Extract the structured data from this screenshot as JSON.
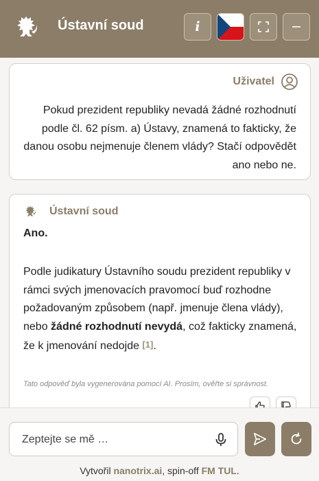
{
  "header": {
    "title": "Ústavní soud",
    "logo_icon": "heraldic-lion-icon",
    "buttons": {
      "info_label": "i",
      "flag_icon": "czech-flag-icon",
      "fullscreen_icon": "fullscreen-icon",
      "minimize_icon": "minimize-icon"
    },
    "background_color": "#8b7d67"
  },
  "messages": {
    "user": {
      "name": "Uživatel",
      "avatar_icon": "user-icon",
      "text": "Pokud prezident republiky nevadá žádné rozhodnutí podle čl. 62 písm. a) Ústavy, znamená to fakticky, že danou osobu nejmenuje členem vlády? Stačí odpovědět ano nebo ne."
    },
    "assistant": {
      "name": "Ústavní soud",
      "avatar_icon": "heraldic-lion-icon",
      "answer": "Ano.",
      "text_part1": "Podle judikatury Ústavního soudu prezident republiky v rámci svých jmenovacích pravomocí buď rozhodne požadovaným způsobem (např. jmenuje člena vlády), nebo ",
      "text_bold": "žádné rozhodnutí nevydá",
      "text_part2": ", což fakticky znamená, že k jmenování nedojde ",
      "citation": "[1]",
      "text_end": ".",
      "disclaimer": "Tato odpověď byla vygenerována pomocí AI. Prosím, ověřte si správnost.",
      "rating_icons": [
        "thumbs-up-icon",
        "thumbs-down-icon"
      ]
    }
  },
  "composer": {
    "placeholder": "Zeptejte se mě …",
    "mic_icon": "microphone-icon",
    "send_icon": "send-icon",
    "reset_icon": "refresh-icon"
  },
  "footer": {
    "prefix": "Vytvořil ",
    "brand1": "nanotrix.ai",
    "middle": ", spin-off ",
    "brand2": "FM TUL",
    "suffix": "."
  },
  "colors": {
    "accent": "#8b7d67",
    "card_border": "#d4d0c9",
    "background": "#f6f5f3"
  }
}
